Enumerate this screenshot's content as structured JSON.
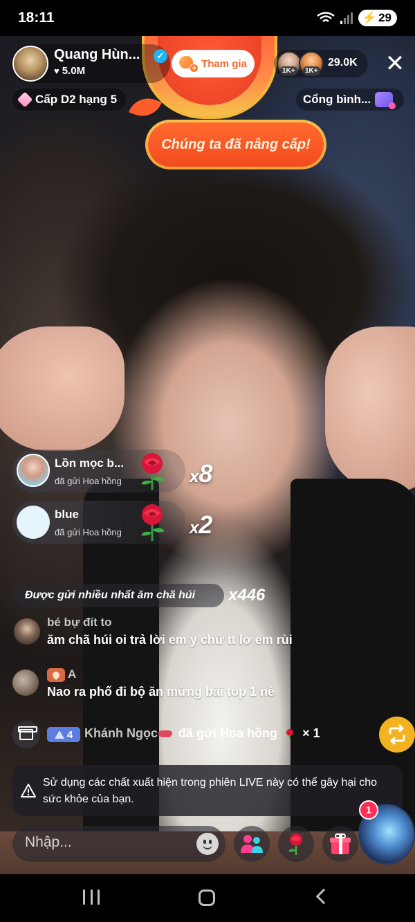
{
  "status_bar": {
    "time": "18:11",
    "battery": "29"
  },
  "host": {
    "name": "Quang Hùn...",
    "likes": "5.0M",
    "verified_icon": "verified-check-icon"
  },
  "join_button": {
    "label": "Tham gia"
  },
  "viewers": {
    "badge_1": "1K+",
    "badge_2": "1K+",
    "count": "29.0K"
  },
  "level": {
    "label": "Cấp D2 hạng 5"
  },
  "portal": {
    "label": "Cổng bình..."
  },
  "upgrade_banner": {
    "text": "Chúng ta đã nâng cấp!"
  },
  "gifts": [
    {
      "name": "Lồn mọc b...",
      "action": "đã gửi Hoa hồng",
      "multiplier": "x",
      "count": "8"
    },
    {
      "name": "blue",
      "action": "đã gửi Hoa hồng",
      "multiplier": "x",
      "count": "2"
    }
  ],
  "top_sender": {
    "text": "Được gửi nhiều nhất ăm chã húi",
    "count": "x446"
  },
  "chat": [
    {
      "user": "bé bự đít to",
      "message": "ăm chã húi oi trả lời em y chứ tt lơ em rùi"
    },
    {
      "user": "A",
      "message": "Nao ra phố đi bộ ăn mừng bài top 1 nè"
    }
  ],
  "system_message": {
    "level": "4",
    "user": "Khánh Ngọc",
    "action": "đã gửi Hoa hồng",
    "count": "× 1"
  },
  "warning": {
    "text": "Sử dụng các chất xuất hiện trong phiên LIVE này có thể gây hại cho sức khỏe của bạn."
  },
  "input": {
    "placeholder": "Nhập..."
  },
  "notification_count": "1",
  "colors": {
    "accent_orange": "#f26a2e",
    "gift_pink": "#ff3f8e",
    "repost_yellow": "#f3b21f",
    "badge_red": "#ff2d55"
  }
}
